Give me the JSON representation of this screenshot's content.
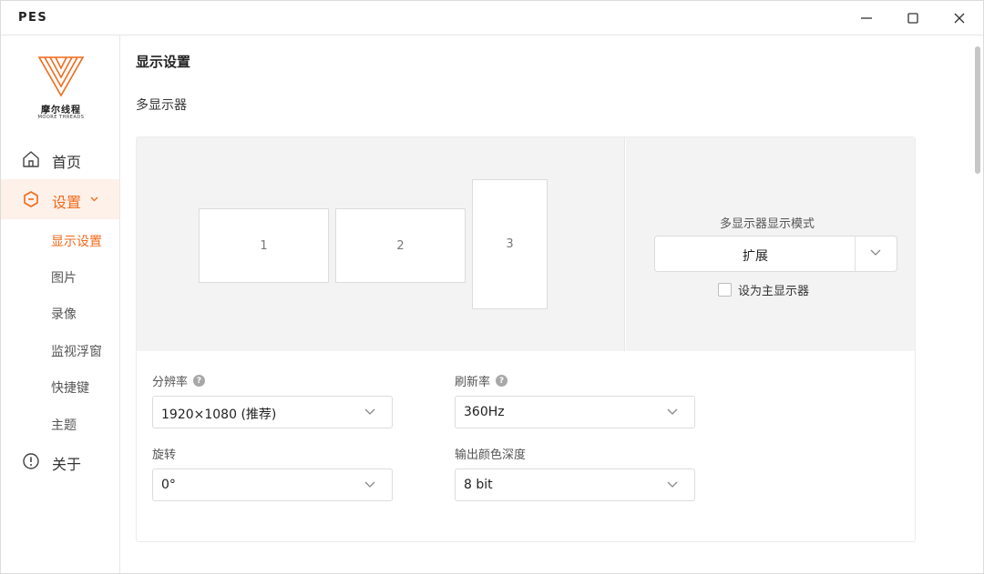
{
  "window": {
    "title": "PES",
    "controls": {
      "minimize": "minimize-icon",
      "maximize": "maximize-icon",
      "close": "close-icon"
    }
  },
  "brand": {
    "name": "摩尔线程",
    "subname": "MOORE THREADS",
    "color": "#f26a1b"
  },
  "sidebar": {
    "items": [
      {
        "label": "首页",
        "icon": "home-icon"
      },
      {
        "label": "设置",
        "icon": "settings-icon",
        "active": true
      },
      {
        "label": "关于",
        "icon": "info-icon"
      }
    ],
    "sub_items": [
      {
        "label": "显示设置",
        "active": true
      },
      {
        "label": "图片"
      },
      {
        "label": "录像"
      },
      {
        "label": "监视浮窗"
      },
      {
        "label": "快捷键"
      },
      {
        "label": "主题"
      }
    ]
  },
  "main": {
    "page_title": "显示设置",
    "section_title": "多显示器",
    "monitors": [
      "1",
      "2",
      "3"
    ],
    "mode": {
      "label": "多显示器显示模式",
      "value": "扩展",
      "primary_checkbox_label": "设为主显示器",
      "primary_checked": false
    },
    "fields": {
      "resolution": {
        "label": "分辨率",
        "value": "1920×1080 (推荐)"
      },
      "refresh": {
        "label": "刷新率",
        "value": "360Hz"
      },
      "rotation": {
        "label": "旋转",
        "value": "0°"
      },
      "color_depth": {
        "label": "输出颜色深度",
        "value": "8 bit"
      }
    },
    "help_glyph": "?"
  }
}
